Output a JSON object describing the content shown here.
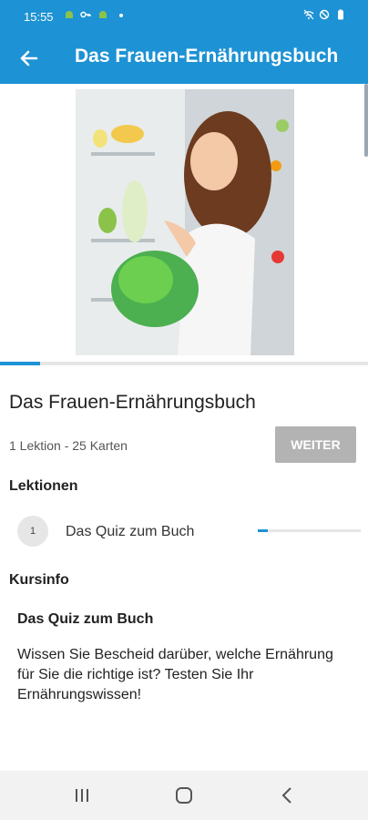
{
  "status_bar": {
    "time": "15:55",
    "icons": [
      "android-icon",
      "key-icon",
      "android-icon",
      "dot-icon",
      "wifi-off-icon",
      "do-not-disturb-icon",
      "battery-icon"
    ]
  },
  "app_bar": {
    "title": "Das Frauen-Ernährungsbuch",
    "back_icon": "arrow-left-icon"
  },
  "hero": {
    "image_description_hidden": ""
  },
  "course": {
    "progress": 0.11,
    "title": "Das Frauen-Ernährungsbuch",
    "meta": "1 Lektion - 25 Karten",
    "continue_label": "WEITER"
  },
  "lessons": {
    "heading": "Lektionen",
    "items": [
      {
        "number": "1",
        "title": "Das Quiz zum Buch",
        "progress": 0.1
      }
    ]
  },
  "course_info": {
    "heading": "Kursinfo",
    "title": "Das Quiz zum Buch",
    "text": "Wissen Sie Bescheid darüber, welche Ernährung für Sie die richtige ist? Testen Sie Ihr Ernährungswissen!"
  },
  "nav_bar": {
    "icons": [
      "recents-icon",
      "home-icon",
      "back-icon"
    ]
  },
  "colors": {
    "primary": "#1d92d4",
    "button_disabled": "#b3b3b3"
  }
}
